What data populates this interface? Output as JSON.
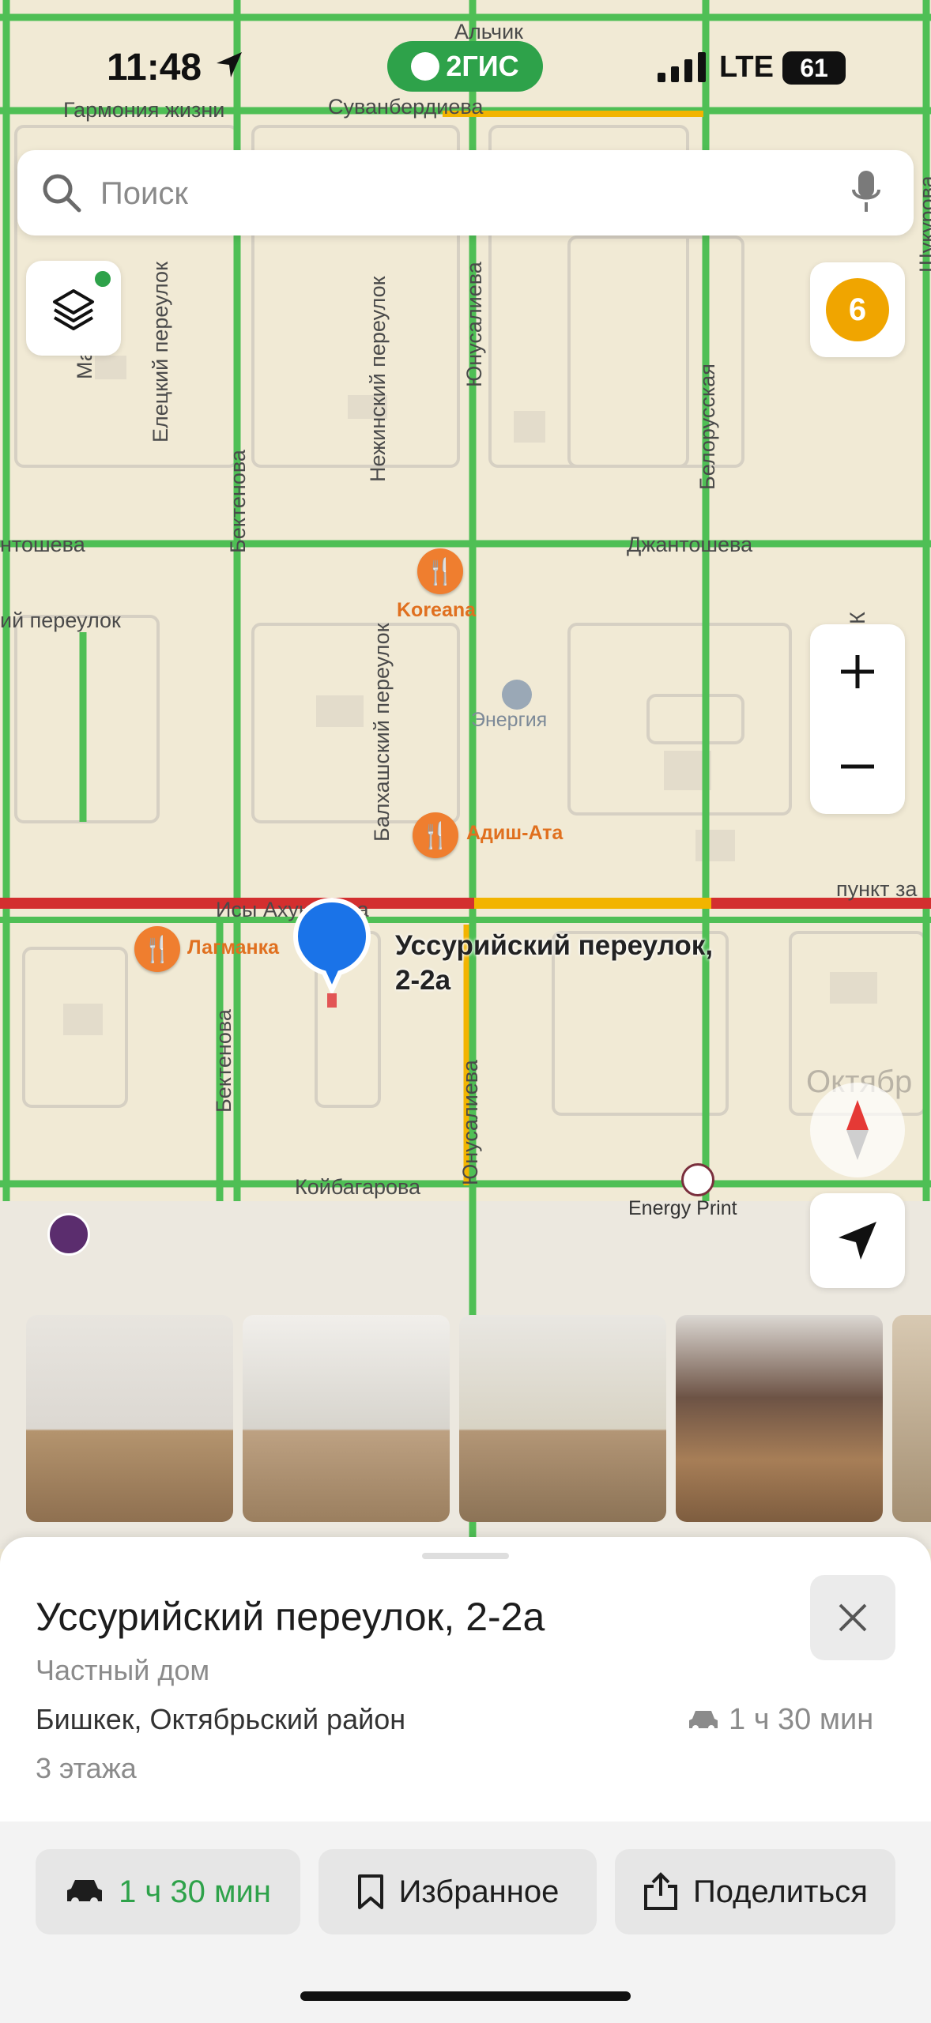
{
  "status_bar": {
    "time": "11:48",
    "network": "LTE",
    "battery": "61",
    "app_badge": "2ГИС"
  },
  "search": {
    "placeholder": "Поиск"
  },
  "map": {
    "street_labels": {
      "alchik": "Альчик",
      "garmonia": "Гармония жизни",
      "suvanberdieva": "Суванбердиева",
      "yeletskiy": "Елецкий переулок",
      "bektenova_n": "Бектенова",
      "nezhinskiy": "Нежинский переулок",
      "yunusalieva_n": "Юнусалиева",
      "belorusskaya": "Белорусская",
      "shukurova": "Шукурова",
      "dzhantosheva_w": "нтошева",
      "dzhantosheva_e": "Джантошева",
      "pereulok_w": "ий переулок",
      "balkhashskiy": "Балхашский переулок",
      "isy_akhunbaeva": "Исы Ахунбаева",
      "bektenova_s": "Бектенова",
      "yunusalieva_s": "Юнусалиева",
      "koybagarova": "Койбагарова",
      "oktyabr": "Октябр",
      "punkt": "пункт за",
      "m_label": "Ма",
      "k_label": "К"
    },
    "pois": {
      "koreana": "Koreana",
      "energiya": "Энергия",
      "adish_ata": "Адиш-Ата",
      "lagmanka": "Лагманка",
      "energy_print": "Energy Print"
    },
    "pin_label": "Уссурийский переулок,\n2-2а",
    "layers_badge": "6"
  },
  "place": {
    "title": "Уссурийский переулок, 2-2а",
    "type": "Частный дом",
    "address": "Бишкек, Октябрьский район",
    "floors": "3 этажа",
    "eta": "1 ч 30 мин"
  },
  "actions": {
    "route": "1 ч 30 мин",
    "favorite": "Избранное",
    "share": "Поделиться"
  },
  "colors": {
    "accent_green": "#2ea24a",
    "traffic_red": "#d32f2f",
    "pin_blue": "#1a73e8",
    "poi_orange": "#ef7e2f",
    "badge_yellow": "#f0a500"
  }
}
